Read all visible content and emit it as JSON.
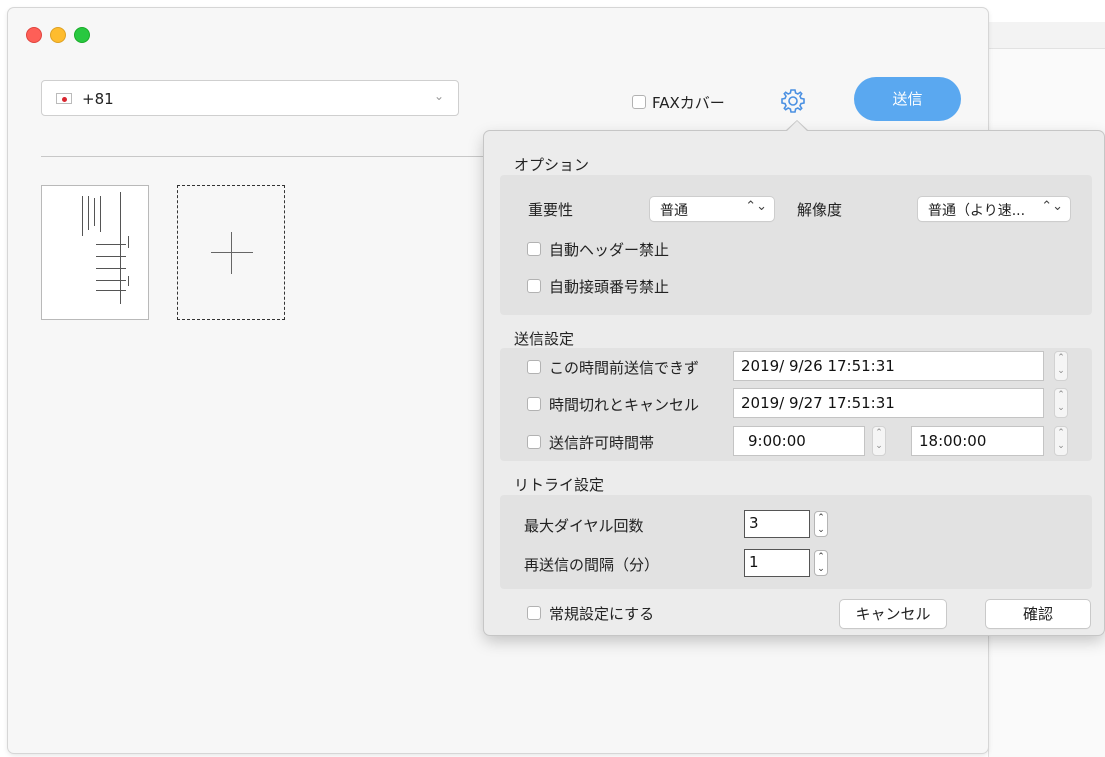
{
  "phone": {
    "country_code": "+81"
  },
  "toolbar": {
    "fax_cover_label": "FAXカバー",
    "send_label": "送信"
  },
  "popover": {
    "options": {
      "title": "オプション",
      "importance_label": "重要性",
      "importance_value": "普通",
      "resolution_label": "解像度",
      "resolution_value": "普通（より速...",
      "no_auto_header": "自動ヘッダー禁止",
      "no_auto_prefix": "自動接頭番号禁止"
    },
    "send_settings": {
      "title": "送信設定",
      "not_before_label": "この時間前送信できず",
      "not_before_value": "2019/ 9/26 17:51:31",
      "cancel_after_label": "時間切れとキャンセル",
      "cancel_after_value": "2019/ 9/27 17:51:31",
      "allowed_window_label": "送信許可時間帯",
      "allowed_start": "9:00:00",
      "allowed_end": "18:00:00"
    },
    "retry": {
      "title": "リトライ設定",
      "max_dial_label": "最大ダイヤル回数",
      "max_dial_value": "3",
      "interval_label": "再送信の間隔（分）",
      "interval_value": "1"
    },
    "footer": {
      "make_default_label": "常規設定にする",
      "cancel_label": "キャンセル",
      "confirm_label": "確認"
    }
  }
}
